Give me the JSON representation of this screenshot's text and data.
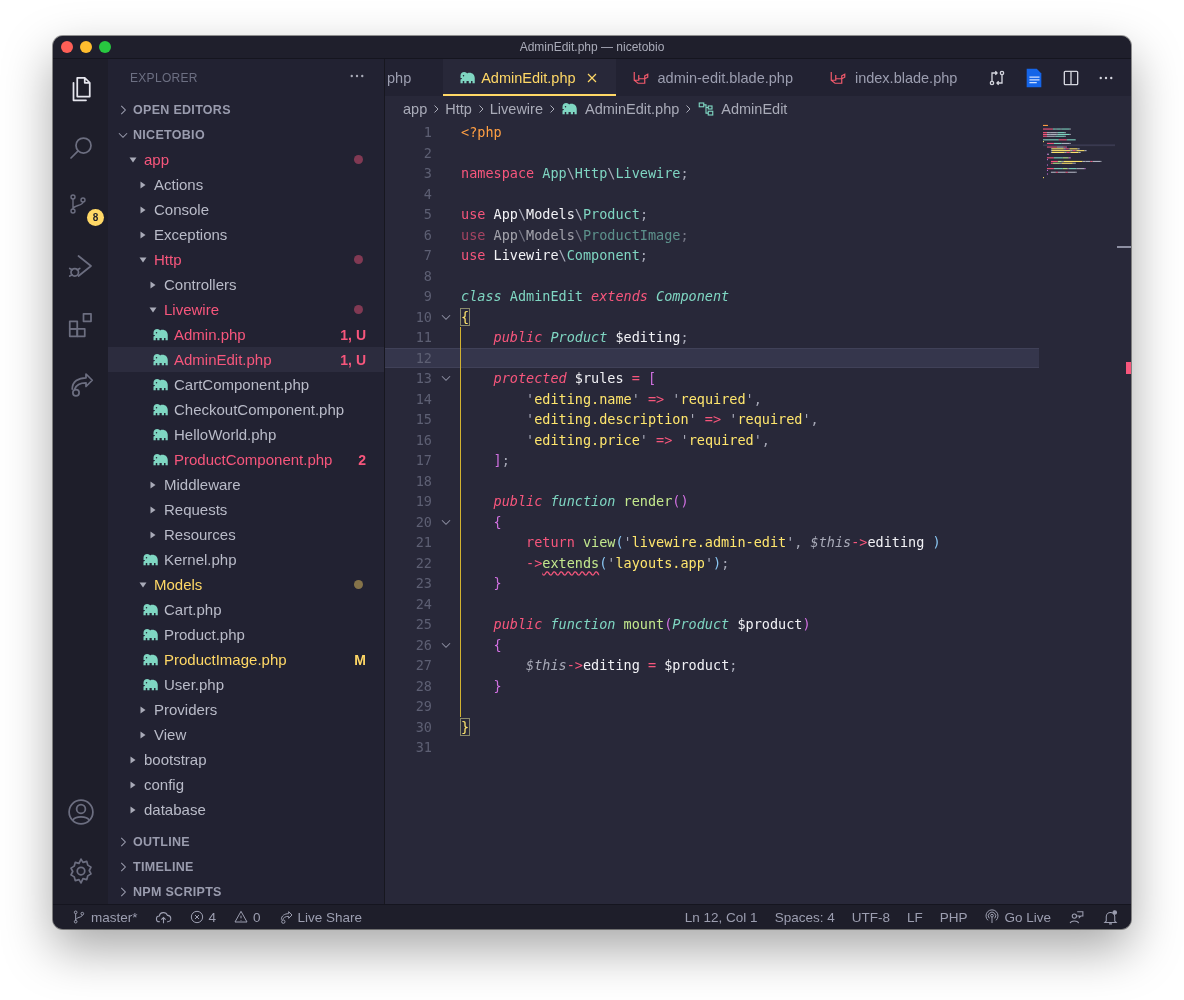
{
  "window": {
    "title": "AdminEdit.php — nicetobio"
  },
  "activity_bar": {
    "items": [
      {
        "kind": "files",
        "selected": true
      },
      {
        "kind": "search",
        "selected": false
      },
      {
        "kind": "source-control",
        "selected": false,
        "badge": "8"
      },
      {
        "kind": "run-debug",
        "selected": false
      },
      {
        "kind": "extensions",
        "selected": false
      },
      {
        "kind": "live-share",
        "selected": false
      }
    ],
    "bottom": [
      {
        "kind": "account"
      },
      {
        "kind": "settings"
      }
    ]
  },
  "sidebar": {
    "title": "EXPLORER",
    "sections": [
      {
        "label": "OPEN EDITORS",
        "expanded": false
      },
      {
        "label": "NICETOBIO",
        "expanded": true,
        "tree": [
          {
            "name": "app",
            "kind": "folder",
            "expanded": true,
            "selected": false,
            "color": "#f7567c",
            "dot": true,
            "children": [
              {
                "name": "Actions",
                "kind": "folder",
                "expanded": false,
                "selected": false
              },
              {
                "name": "Console",
                "kind": "folder",
                "expanded": false,
                "selected": false
              },
              {
                "name": "Exceptions",
                "kind": "folder",
                "expanded": false,
                "selected": false
              },
              {
                "name": "Http",
                "kind": "folder",
                "expanded": true,
                "selected": false,
                "color": "#f7567c",
                "dot": true,
                "children": [
                  {
                    "name": "Controllers",
                    "kind": "folder",
                    "expanded": false,
                    "selected": false
                  },
                  {
                    "name": "Livewire",
                    "kind": "folder",
                    "expanded": true,
                    "selected": false,
                    "color": "#f7567c",
                    "dot": true,
                    "children": [
                      {
                        "name": "Admin.php",
                        "kind": "php",
                        "selected": false,
                        "color": "#f7567c",
                        "badge": "1, U"
                      },
                      {
                        "name": "AdminEdit.php",
                        "kind": "php",
                        "selected": true,
                        "color": "#f7567c",
                        "badge": "1, U"
                      },
                      {
                        "name": "CartComponent.php",
                        "kind": "php",
                        "selected": false
                      },
                      {
                        "name": "CheckoutComponent.php",
                        "kind": "php",
                        "selected": false
                      },
                      {
                        "name": "HelloWorld.php",
                        "kind": "php",
                        "selected": false
                      },
                      {
                        "name": "ProductComponent.php",
                        "kind": "php",
                        "selected": false,
                        "color": "#f7567c",
                        "badge": "2"
                      }
                    ]
                  },
                  {
                    "name": "Middleware",
                    "kind": "folder",
                    "expanded": false,
                    "selected": false
                  },
                  {
                    "name": "Requests",
                    "kind": "folder",
                    "expanded": false,
                    "selected": false
                  },
                  {
                    "name": "Resources",
                    "kind": "folder",
                    "expanded": false,
                    "selected": false
                  },
                  {
                    "name": "Kernel.php",
                    "kind": "php",
                    "selected": false
                  }
                ]
              },
              {
                "name": "Models",
                "kind": "folder",
                "expanded": true,
                "selected": false,
                "color": "#ffd866",
                "dot": true,
                "children": [
                  {
                    "name": "Cart.php",
                    "kind": "php",
                    "selected": false
                  },
                  {
                    "name": "Product.php",
                    "kind": "php",
                    "selected": false
                  },
                  {
                    "name": "ProductImage.php",
                    "kind": "php",
                    "selected": false,
                    "color": "#ffd866",
                    "badge": "M"
                  },
                  {
                    "name": "User.php",
                    "kind": "php",
                    "selected": false
                  }
                ]
              },
              {
                "name": "Providers",
                "kind": "folder",
                "expanded": false,
                "selected": false
              },
              {
                "name": "View",
                "kind": "folder",
                "expanded": false,
                "selected": false
              }
            ]
          },
          {
            "name": "bootstrap",
            "kind": "folder",
            "expanded": false,
            "selected": false
          },
          {
            "name": "config",
            "kind": "folder",
            "expanded": false,
            "selected": false
          },
          {
            "name": "database",
            "kind": "folder",
            "expanded": false,
            "selected": false
          }
        ]
      },
      {
        "label": "OUTLINE",
        "expanded": false
      },
      {
        "label": "TIMELINE",
        "expanded": false
      },
      {
        "label": "NPM SCRIPTS",
        "expanded": false
      }
    ]
  },
  "tabs": [
    {
      "label": "php",
      "kind": "partial",
      "selected": false
    },
    {
      "label": "AdminEdit.php",
      "kind": "php",
      "selected": true
    },
    {
      "label": "admin-edit.blade.php",
      "kind": "blade",
      "selected": false
    },
    {
      "label": "index.blade.php",
      "kind": "blade",
      "selected": false
    }
  ],
  "editor_actions": [
    {
      "kind": "compare"
    },
    {
      "kind": "php-file"
    },
    {
      "kind": "split"
    },
    {
      "kind": "more"
    }
  ],
  "breadcrumb": [
    {
      "label": "app",
      "kind": "folder"
    },
    {
      "label": "Http",
      "kind": "folder"
    },
    {
      "label": "Livewire",
      "kind": "folder"
    },
    {
      "label": "AdminEdit.php",
      "kind": "php"
    },
    {
      "label": "AdminEdit",
      "kind": "class"
    }
  ],
  "code": {
    "lines": [
      {
        "n": "1",
        "fold": false,
        "guide": false,
        "current": false,
        "dim": false,
        "t": [
          {
            "kind": "php",
            "text": "<?php"
          }
        ]
      },
      {
        "n": "2",
        "fold": false,
        "guide": false,
        "current": false,
        "dim": false
      },
      {
        "n": "3",
        "fold": false,
        "guide": false,
        "current": false,
        "dim": false,
        "t": [
          {
            "kind": "kw",
            "text": "namespace "
          },
          {
            "kind": "ty",
            "text": "App"
          },
          {
            "kind": "p",
            "text": "\\"
          },
          {
            "kind": "ty",
            "text": "Http"
          },
          {
            "kind": "p",
            "text": "\\"
          },
          {
            "kind": "ty",
            "text": "Livewire"
          },
          {
            "kind": "p",
            "text": ";"
          }
        ]
      },
      {
        "n": "4",
        "fold": false,
        "guide": false,
        "current": false,
        "dim": false
      },
      {
        "n": "5",
        "fold": false,
        "guide": false,
        "current": false,
        "dim": false,
        "t": [
          {
            "kind": "kw",
            "text": "use "
          },
          {
            "kind": "id",
            "text": "App"
          },
          {
            "kind": "p",
            "text": "\\"
          },
          {
            "kind": "id",
            "text": "Models"
          },
          {
            "kind": "p",
            "text": "\\"
          },
          {
            "kind": "ty",
            "text": "Product"
          },
          {
            "kind": "p",
            "text": ";"
          }
        ]
      },
      {
        "n": "6",
        "fold": false,
        "guide": false,
        "current": false,
        "dim": true,
        "t": [
          {
            "kind": "kw",
            "text": "use "
          },
          {
            "kind": "id",
            "text": "App"
          },
          {
            "kind": "p",
            "text": "\\"
          },
          {
            "kind": "id",
            "text": "Models"
          },
          {
            "kind": "p",
            "text": "\\"
          },
          {
            "kind": "ty",
            "text": "ProductImage"
          },
          {
            "kind": "p",
            "text": ";"
          }
        ]
      },
      {
        "n": "7",
        "fold": false,
        "guide": false,
        "current": false,
        "dim": false,
        "t": [
          {
            "kind": "kw",
            "text": "use "
          },
          {
            "kind": "id",
            "text": "Livewire"
          },
          {
            "kind": "p",
            "text": "\\"
          },
          {
            "kind": "ty",
            "text": "Component"
          },
          {
            "kind": "p",
            "text": ";"
          }
        ]
      },
      {
        "n": "8",
        "fold": false,
        "guide": false,
        "current": false,
        "dim": false
      },
      {
        "n": "9",
        "fold": false,
        "guide": false,
        "current": false,
        "dim": false,
        "t": [
          {
            "kind": "tyi",
            "text": "class "
          },
          {
            "kind": "ty",
            "text": "AdminEdit "
          },
          {
            "kind": "kwi",
            "text": "extends "
          },
          {
            "kind": "tyi",
            "text": "Component"
          }
        ]
      },
      {
        "n": "10",
        "fold": true,
        "guide": false,
        "current": false,
        "dim": false,
        "t": [
          {
            "kind": "m",
            "text": "{"
          }
        ]
      },
      {
        "n": "11",
        "fold": false,
        "guide": true,
        "current": false,
        "dim": false,
        "t": [
          {
            "kind": "kwi",
            "text": "    public "
          },
          {
            "kind": "tyi",
            "text": "Product "
          },
          {
            "kind": "id",
            "text": "$editing"
          },
          {
            "kind": "p",
            "text": ";"
          }
        ]
      },
      {
        "n": "12",
        "fold": false,
        "guide": true,
        "current": true,
        "dim": false
      },
      {
        "n": "13",
        "fold": true,
        "guide": true,
        "current": false,
        "dim": false,
        "t": [
          {
            "kind": "kwi",
            "text": "    protected "
          },
          {
            "kind": "id",
            "text": "$rules "
          },
          {
            "kind": "op",
            "text": "= "
          },
          {
            "kind": "br",
            "text": "["
          }
        ]
      },
      {
        "n": "14",
        "fold": false,
        "guide": true,
        "current": false,
        "dim": false,
        "t": [
          {
            "kind": "p",
            "text": "        '"
          },
          {
            "kind": "s",
            "text": "editing.name"
          },
          {
            "kind": "p",
            "text": "' "
          },
          {
            "kind": "op",
            "text": "=> "
          },
          {
            "kind": "p",
            "text": "'"
          },
          {
            "kind": "s",
            "text": "required"
          },
          {
            "kind": "p",
            "text": "',"
          }
        ]
      },
      {
        "n": "15",
        "fold": false,
        "guide": true,
        "current": false,
        "dim": false,
        "t": [
          {
            "kind": "p",
            "text": "        '"
          },
          {
            "kind": "s",
            "text": "editing.description"
          },
          {
            "kind": "p",
            "text": "' "
          },
          {
            "kind": "op",
            "text": "=> "
          },
          {
            "kind": "p",
            "text": "'"
          },
          {
            "kind": "s",
            "text": "required"
          },
          {
            "kind": "p",
            "text": "',"
          }
        ]
      },
      {
        "n": "16",
        "fold": false,
        "guide": true,
        "current": false,
        "dim": false,
        "t": [
          {
            "kind": "p",
            "text": "        '"
          },
          {
            "kind": "s",
            "text": "editing.price"
          },
          {
            "kind": "p",
            "text": "' "
          },
          {
            "kind": "op",
            "text": "=> "
          },
          {
            "kind": "p",
            "text": "'"
          },
          {
            "kind": "s",
            "text": "required"
          },
          {
            "kind": "p",
            "text": "',"
          }
        ]
      },
      {
        "n": "17",
        "fold": false,
        "guide": true,
        "current": false,
        "dim": false,
        "t": [
          {
            "kind": "br",
            "text": "    ]"
          },
          {
            "kind": "p",
            "text": ";"
          }
        ]
      },
      {
        "n": "18",
        "fold": false,
        "guide": true,
        "current": false,
        "dim": false
      },
      {
        "n": "19",
        "fold": false,
        "guide": true,
        "current": false,
        "dim": false,
        "t": [
          {
            "kind": "kwi",
            "text": "    public "
          },
          {
            "kind": "tyi",
            "text": "function "
          },
          {
            "kind": "fn",
            "text": "render"
          },
          {
            "kind": "br",
            "text": "()"
          }
        ]
      },
      {
        "n": "20",
        "fold": true,
        "guide": true,
        "current": false,
        "dim": false,
        "t": [
          {
            "kind": "br",
            "text": "    {"
          }
        ]
      },
      {
        "n": "21",
        "fold": false,
        "guide": true,
        "current": false,
        "dim": false,
        "t": [
          {
            "kind": "kw",
            "text": "        return "
          },
          {
            "kind": "fn",
            "text": "view"
          },
          {
            "kind": "pa",
            "text": "("
          },
          {
            "kind": "p",
            "text": "'"
          },
          {
            "kind": "s",
            "text": "livewire.admin-edit"
          },
          {
            "kind": "p",
            "text": "', "
          },
          {
            "kind": "self",
            "text": "$this"
          },
          {
            "kind": "op",
            "text": "->"
          },
          {
            "kind": "id",
            "text": "editing "
          },
          {
            "kind": "pa",
            "text": ")"
          }
        ]
      },
      {
        "n": "22",
        "fold": false,
        "guide": true,
        "current": false,
        "dim": false,
        "t": [
          {
            "kind": "op",
            "text": "        ->"
          },
          {
            "kind": "err",
            "text": "extends"
          },
          {
            "kind": "pa",
            "text": "("
          },
          {
            "kind": "p",
            "text": "'"
          },
          {
            "kind": "s",
            "text": "layouts.app"
          },
          {
            "kind": "p",
            "text": "'"
          },
          {
            "kind": "pa",
            "text": ")"
          },
          {
            "kind": "p",
            "text": ";"
          }
        ]
      },
      {
        "n": "23",
        "fold": false,
        "guide": true,
        "current": false,
        "dim": false,
        "t": [
          {
            "kind": "br",
            "text": "    }"
          }
        ]
      },
      {
        "n": "24",
        "fold": false,
        "guide": true,
        "current": false,
        "dim": false
      },
      {
        "n": "25",
        "fold": false,
        "guide": true,
        "current": false,
        "dim": false,
        "t": [
          {
            "kind": "kwi",
            "text": "    public "
          },
          {
            "kind": "tyi",
            "text": "function "
          },
          {
            "kind": "fn",
            "text": "mount"
          },
          {
            "kind": "br",
            "text": "("
          },
          {
            "kind": "tyi",
            "text": "Product "
          },
          {
            "kind": "id",
            "text": "$product"
          },
          {
            "kind": "br",
            "text": ")"
          }
        ]
      },
      {
        "n": "26",
        "fold": true,
        "guide": true,
        "current": false,
        "dim": false,
        "t": [
          {
            "kind": "br",
            "text": "    {"
          }
        ]
      },
      {
        "n": "27",
        "fold": false,
        "guide": true,
        "current": false,
        "dim": false,
        "t": [
          {
            "kind": "self",
            "text": "        $this"
          },
          {
            "kind": "op",
            "text": "->"
          },
          {
            "kind": "id",
            "text": "editing "
          },
          {
            "kind": "op",
            "text": "= "
          },
          {
            "kind": "id",
            "text": "$product"
          },
          {
            "kind": "p",
            "text": ";"
          }
        ]
      },
      {
        "n": "28",
        "fold": false,
        "guide": true,
        "current": false,
        "dim": false,
        "t": [
          {
            "kind": "br",
            "text": "    }"
          }
        ]
      },
      {
        "n": "29",
        "fold": false,
        "guide": true,
        "current": false,
        "dim": false
      },
      {
        "n": "30",
        "fold": false,
        "guide": false,
        "current": false,
        "dim": false,
        "t": [
          {
            "kind": "m",
            "text": "}"
          }
        ]
      },
      {
        "n": "31",
        "fold": false,
        "guide": false,
        "current": false,
        "dim": false
      }
    ]
  },
  "status_bar": {
    "left": [
      {
        "kind": "branch",
        "label": "master*"
      },
      {
        "kind": "sync"
      },
      {
        "kind": "error",
        "label": "4"
      },
      {
        "kind": "warning",
        "label": "0"
      },
      {
        "kind": "live-share",
        "label": "Live Share"
      }
    ],
    "right": [
      {
        "label": "Ln 12, Col 1"
      },
      {
        "label": "Spaces: 4"
      },
      {
        "label": "UTF-8"
      },
      {
        "label": "LF"
      },
      {
        "label": "PHP"
      },
      {
        "kind": "broadcast",
        "label": "Go Live"
      },
      {
        "kind": "feedback"
      },
      {
        "kind": "bell"
      }
    ]
  }
}
